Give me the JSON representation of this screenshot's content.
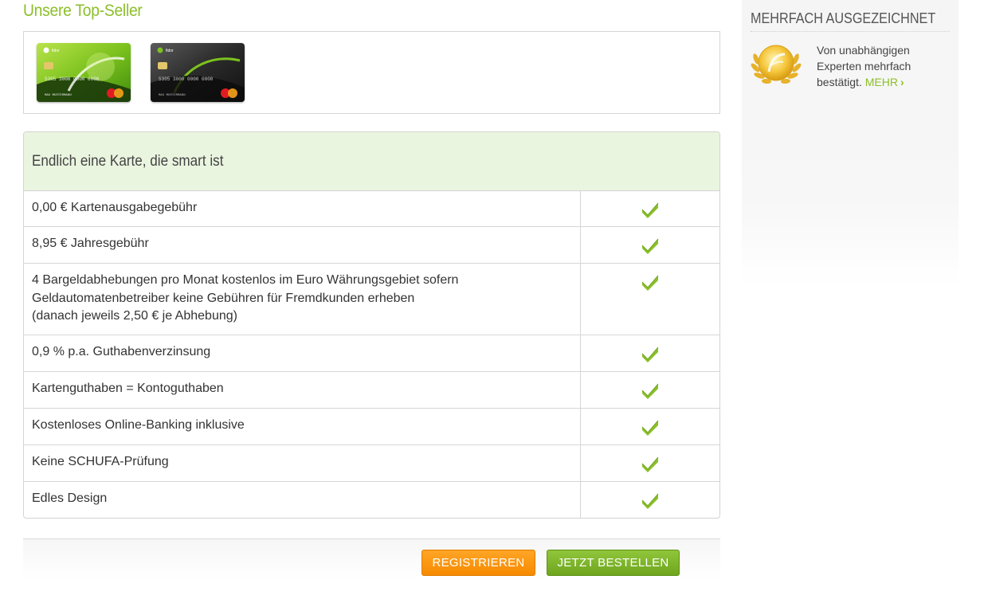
{
  "topseller": {
    "heading": "Unsere Top-Seller"
  },
  "cards": [
    {
      "name": "green-card",
      "number": "5305 3000 0000 0000",
      "holder": "MAX MUSTERMANN",
      "brand": "MasterCard"
    },
    {
      "name": "black-card",
      "number": "5305 3000 0000 0000",
      "holder": "MAX MUSTERMANN",
      "brand": "MasterCard"
    }
  ],
  "table": {
    "title": "Endlich eine Karte, die smart ist",
    "rows": [
      {
        "lines": [
          "0,00 € Kartenausgabegebühr"
        ],
        "checked": true
      },
      {
        "lines": [
          "8,95 € Jahresgebühr"
        ],
        "checked": true
      },
      {
        "lines": [
          "4 Bargeldabhebungen pro Monat kostenlos im Euro Währungsgebiet sofern",
          "Geldautomatenbetreiber keine Gebühren für Fremdkunden erheben",
          "(danach jeweils 2,50 € je Abhebung)"
        ],
        "checked": true
      },
      {
        "lines": [
          "0,9 % p.a. Guthabenverzinsung"
        ],
        "checked": true
      },
      {
        "lines": [
          "Kartenguthaben = Kontoguthaben"
        ],
        "checked": true
      },
      {
        "lines": [
          "Kostenloses Online-Banking inklusive"
        ],
        "checked": true
      },
      {
        "lines": [
          "Keine SCHUFA-Prüfung"
        ],
        "checked": true
      },
      {
        "lines": [
          "Edles Design"
        ],
        "checked": true
      }
    ]
  },
  "buttons": {
    "register": "REGISTRIEREN",
    "order": "JETZT BESTELLEN"
  },
  "sidebar": {
    "title": "MEHRFACH AUSGEZEICHNET",
    "text_lines": [
      "Von unabhängigen",
      "Experten mehrfach",
      "bestätigt."
    ],
    "more_label": "MEHR",
    "more_chevron": "›",
    "award_icon": "award-laurel-icon"
  },
  "colors": {
    "accent_green": "#8cbf2a",
    "orange_button": "#f68a00",
    "green_button": "#6ea51e",
    "table_header_bg": "#eaf5e0"
  }
}
